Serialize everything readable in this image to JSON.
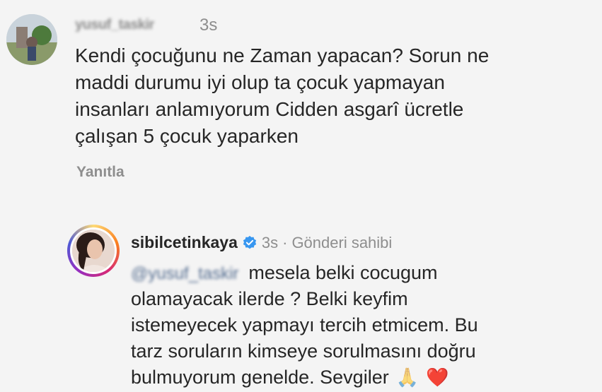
{
  "comment": {
    "username": "yusuf_taskir",
    "time": "3s",
    "text_lines": [
      "Kendi çocuğunu ne Zaman yapacan? Sorun ne",
      "maddi durumu iyi olup ta çocuk yapmayan",
      "insanları anlamıyorum Cidden asgarî ücretle",
      "çalışan 5 çocuk yaparken"
    ],
    "reply_label": "Yanıtla"
  },
  "reply": {
    "username": "sibilcetinkaya",
    "time": "3s",
    "separator": "·",
    "owner_label": "Gönderi sahibi",
    "mention": "@yusuf_taskir",
    "first_line_rest": "mesela belki cocugum",
    "text_lines": [
      "olamayacak ilerde ? Belki keyfim",
      "istemeyecek yapmayı tercih etmicem. Bu",
      "tarz soruların kimseye sorulmasını doğru",
      "bulmuyorum genelde. Sevgiler"
    ],
    "emojis": [
      "🙏",
      "❤️"
    ]
  },
  "colors": {
    "text": "#262626",
    "muted": "#8e8e8e",
    "verified": "#3897f0",
    "heart": "#e0242f"
  }
}
